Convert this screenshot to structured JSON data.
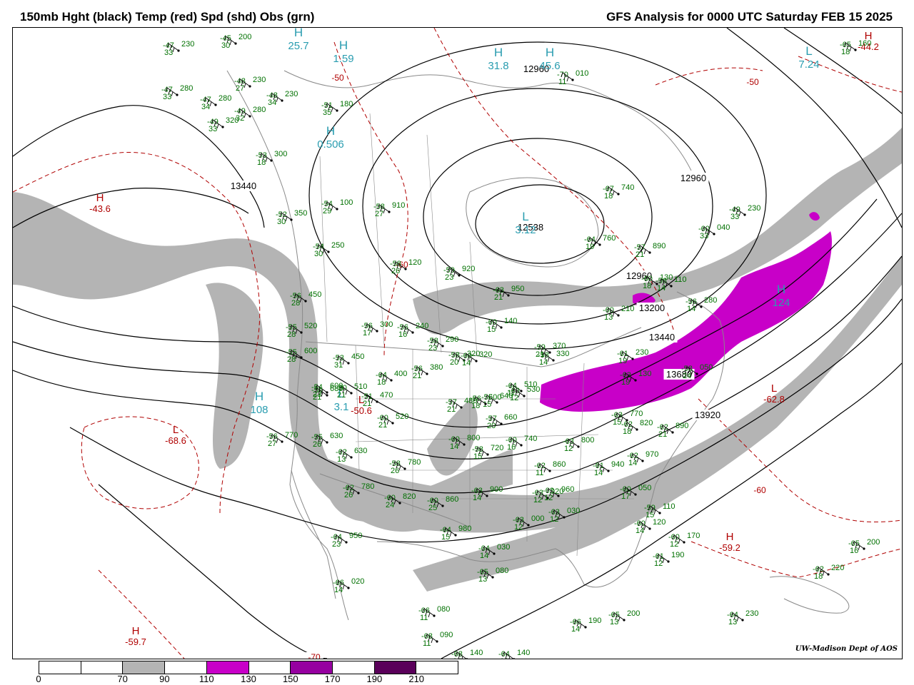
{
  "header": {
    "left_title": "150mb Hght (black) Temp (red) Spd (shd) Obs (grn)",
    "right_title": "GFS Analysis for 0000 UTC Saturday  FEB 15 2025"
  },
  "colors": {
    "height": "#000000",
    "temp": "#b00000",
    "obs": "#007000",
    "center": "#2a9db0",
    "speed_70": "#b4b4b4",
    "speed_110": "#c800c8",
    "speed_150": "#9600a0",
    "speed_190": "#5a005a"
  },
  "legend": {
    "labels": [
      "0",
      "70",
      "90",
      "110",
      "130",
      "150",
      "170",
      "190",
      "210"
    ],
    "fills": [
      "#ffffff",
      "#ffffff",
      "#b4b4b4",
      "#ffffff",
      "#c800c8",
      "#ffffff",
      "#9600a0",
      "#ffffff",
      "#5a005a",
      "#ffffff"
    ]
  },
  "height_labels": [
    "13440",
    "12960",
    "12960",
    "12960",
    "12538",
    "13200",
    "13440",
    "13680",
    "13920"
  ],
  "temp_extrema": [
    {
      "type": "H",
      "value": "-43.6"
    },
    {
      "type": "H",
      "value": "-44.2"
    },
    {
      "type": "H",
      "value": "-59.2"
    },
    {
      "type": "H",
      "value": "-59.7"
    },
    {
      "type": "L",
      "value": "-68.6"
    },
    {
      "type": "L",
      "value": "-62.8"
    },
    {
      "type": "L",
      "value": "-50.6"
    }
  ],
  "temp_contour_labels": [
    "-50",
    "-50",
    "-60",
    "-60",
    "-70"
  ],
  "speed_centers": [
    {
      "type": "H",
      "value": "25.7"
    },
    {
      "type": "H",
      "value": "1.59"
    },
    {
      "type": "H",
      "value": "31.8"
    },
    {
      "type": "H",
      "value": "45.6"
    },
    {
      "type": "H",
      "value": "0.506"
    },
    {
      "type": "H",
      "value": "108"
    },
    {
      "type": "H",
      "value": "124"
    },
    {
      "type": "L",
      "value": "7.24"
    },
    {
      "type": "L",
      "value": "3.12"
    },
    {
      "type": "L",
      "value": "3.1"
    }
  ],
  "observations": [
    {
      "t": "-47",
      "h": "230",
      "d": "33"
    },
    {
      "t": "-45",
      "h": "200",
      "d": "30"
    },
    {
      "t": "-47",
      "h": "280",
      "d": "33"
    },
    {
      "t": "-48",
      "h": "230",
      "d": "27"
    },
    {
      "t": "-48",
      "h": "230",
      "d": "34"
    },
    {
      "t": "-47",
      "h": "280",
      "d": "34"
    },
    {
      "t": "-49",
      "h": "280",
      "d": "32"
    },
    {
      "t": "-49",
      "h": "320",
      "d": "33"
    },
    {
      "t": "-51",
      "h": "180",
      "d": "35"
    },
    {
      "t": "-53",
      "h": "300",
      "d": "18"
    },
    {
      "t": "-54",
      "h": "100",
      "d": "29"
    },
    {
      "t": "-52",
      "h": "350",
      "d": "30"
    },
    {
      "t": "-54",
      "h": "250",
      "d": "30"
    },
    {
      "t": "-58",
      "h": "120",
      "d": "26"
    },
    {
      "t": "-56",
      "h": "450",
      "d": "28"
    },
    {
      "t": "-55",
      "h": "520",
      "d": "28"
    },
    {
      "t": "-55",
      "h": "600",
      "d": "28"
    },
    {
      "t": "-53",
      "h": "450",
      "d": "31"
    },
    {
      "t": "-54",
      "h": "600",
      "d": "23"
    },
    {
      "t": "-56",
      "h": "300",
      "d": "17"
    },
    {
      "t": "-56",
      "h": "240",
      "d": "16"
    },
    {
      "t": "-58",
      "h": "290",
      "d": "23"
    },
    {
      "t": "-58",
      "h": "320",
      "d": "20"
    },
    {
      "t": "-64",
      "h": "400",
      "d": "18"
    },
    {
      "t": "-56",
      "h": "380",
      "d": "21"
    },
    {
      "t": "-59",
      "h": "920",
      "d": "23"
    },
    {
      "t": "-63",
      "h": "950",
      "d": "21"
    },
    {
      "t": "-64",
      "h": "760",
      "d": "19"
    },
    {
      "t": "-67",
      "h": "740",
      "d": "18"
    },
    {
      "t": "-57",
      "h": "890",
      "d": "21"
    },
    {
      "t": "-60",
      "h": "040",
      "d": "33"
    },
    {
      "t": "-49",
      "h": "230",
      "d": "33"
    },
    {
      "t": "-65",
      "h": "160",
      "d": "18"
    },
    {
      "t": "-70",
      "h": "010",
      "d": "11"
    },
    {
      "t": "-58",
      "h": "910",
      "d": "27"
    },
    {
      "t": "-62",
      "h": "630",
      "d": "13"
    },
    {
      "t": "-58",
      "h": "780",
      "d": "26"
    },
    {
      "t": "-56",
      "h": "770",
      "d": "27"
    },
    {
      "t": "-55",
      "h": "630",
      "d": "26"
    },
    {
      "t": "-62",
      "h": "780",
      "d": "26"
    },
    {
      "t": "-60",
      "h": "820",
      "d": "24"
    },
    {
      "t": "-60",
      "h": "860",
      "d": "25"
    },
    {
      "t": "-64",
      "h": "950",
      "d": "23"
    },
    {
      "t": "-64",
      "h": "980",
      "d": "15"
    },
    {
      "t": "-64",
      "h": "030",
      "d": "14"
    },
    {
      "t": "-65",
      "h": "080",
      "d": "13"
    },
    {
      "t": "-66",
      "h": "020",
      "d": "14"
    },
    {
      "t": "-66",
      "h": "080",
      "d": "11"
    },
    {
      "t": "-68",
      "h": "090",
      "d": "11"
    },
    {
      "t": "-68",
      "h": "140",
      "d": "14"
    },
    {
      "t": "-64",
      "h": "140",
      "d": "13"
    },
    {
      "t": "-66",
      "h": "190",
      "d": "14"
    },
    {
      "t": "-65",
      "h": "200",
      "d": "13"
    },
    {
      "t": "-64",
      "h": "230",
      "d": "13"
    },
    {
      "t": "-62",
      "h": "220",
      "d": "18"
    },
    {
      "t": "-65",
      "h": "200",
      "d": "16"
    },
    {
      "t": "-61",
      "h": "190",
      "d": "12"
    },
    {
      "t": "-60",
      "h": "170",
      "d": "12"
    },
    {
      "t": "-60",
      "h": "120",
      "d": "14"
    },
    {
      "t": "-59",
      "h": "110",
      "d": "15"
    },
    {
      "t": "-60",
      "h": "050",
      "d": "17"
    },
    {
      "t": "-61",
      "h": "940",
      "d": "14"
    },
    {
      "t": "-62",
      "h": "970",
      "d": "14"
    },
    {
      "t": "-62",
      "h": "890",
      "d": "21"
    },
    {
      "t": "-62",
      "h": "820",
      "d": "18"
    },
    {
      "t": "-63",
      "h": "770",
      "d": "15"
    },
    {
      "t": "-63",
      "h": "800",
      "d": "12"
    },
    {
      "t": "-62",
      "h": "860",
      "d": "11"
    },
    {
      "t": "-63",
      "h": "920",
      "d": "12"
    },
    {
      "t": "-63",
      "h": "900",
      "d": "14"
    },
    {
      "t": "-62",
      "h": "960",
      "d": "12"
    },
    {
      "t": "-63",
      "h": "000",
      "d": "12"
    },
    {
      "t": "-63",
      "h": "030",
      "d": "12"
    },
    {
      "t": "-60",
      "h": "740",
      "d": "16"
    },
    {
      "t": "-58",
      "h": "720",
      "d": "15"
    },
    {
      "t": "-60",
      "h": "800",
      "d": "14"
    },
    {
      "t": "-57",
      "h": "660",
      "d": "20"
    },
    {
      "t": "-56",
      "h": "640",
      "d": "15"
    },
    {
      "t": "-56",
      "h": "500",
      "d": "18"
    },
    {
      "t": "-57",
      "h": "480",
      "d": "21"
    },
    {
      "t": "-60",
      "h": "520",
      "d": "21"
    },
    {
      "t": "-51",
      "h": "470",
      "d": "21"
    },
    {
      "t": "-50",
      "h": "510",
      "d": "21"
    },
    {
      "t": "-60",
      "h": "140",
      "d": "15"
    },
    {
      "t": "-60",
      "h": "320",
      "d": "14"
    },
    {
      "t": "-58",
      "h": "330",
      "d": "14"
    },
    {
      "t": "-60",
      "h": "210",
      "d": "13"
    },
    {
      "t": "-60",
      "h": "130",
      "d": "18"
    },
    {
      "t": "-56",
      "h": "110",
      "d": "14"
    },
    {
      "t": "-56",
      "h": "280",
      "d": "14"
    },
    {
      "t": "-59",
      "h": "370",
      "d": "21"
    },
    {
      "t": "-64",
      "h": "510",
      "d": "11"
    },
    {
      "t": "-61",
      "h": "230",
      "d": "19"
    },
    {
      "t": "-63",
      "h": "130",
      "d": "19"
    },
    {
      "t": "-58",
      "h": "050",
      "d": "24"
    },
    {
      "t": "-63",
      "h": "530",
      "d": "12"
    },
    {
      "t": "-54",
      "h": "680",
      "d": "21"
    }
  ],
  "credit": "UW-Madison  Dept of AOS"
}
